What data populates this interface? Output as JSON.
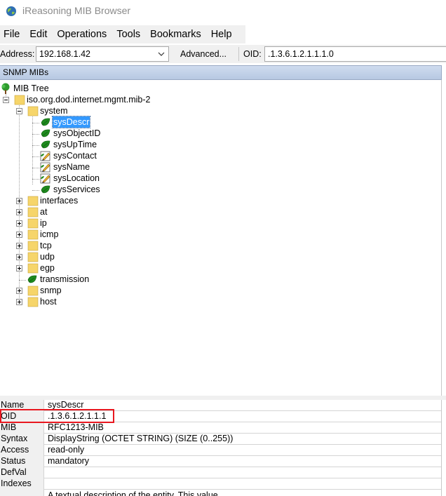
{
  "window": {
    "title": "iReasoning MIB Browser",
    "icon": "globe-icon"
  },
  "menu": [
    "File",
    "Edit",
    "Operations",
    "Tools",
    "Bookmarks",
    "Help"
  ],
  "toolbar": {
    "address_label": "Address:",
    "address_value": "192.168.1.42",
    "advanced_label": "Advanced...",
    "oid_label": "OID:",
    "oid_value": ".1.3.6.1.2.1.1.1.0"
  },
  "tree_panel": {
    "header": "SNMP MIBs",
    "nodes": [
      {
        "label": "MIB Tree",
        "icon": "tree-icon"
      },
      {
        "label": "iso.org.dod.internet.mgmt.mib-2",
        "icon": "folder-icon",
        "expanded": true
      },
      {
        "label": "system",
        "icon": "folder-icon",
        "expanded": true
      },
      {
        "label": "sysDescr",
        "icon": "leaf-icon",
        "selected": true
      },
      {
        "label": "sysObjectID",
        "icon": "leaf-icon"
      },
      {
        "label": "sysUpTime",
        "icon": "leaf-icon"
      },
      {
        "label": "sysContact",
        "icon": "writable-leaf-icon"
      },
      {
        "label": "sysName",
        "icon": "writable-leaf-icon"
      },
      {
        "label": "sysLocation",
        "icon": "writable-leaf-icon"
      },
      {
        "label": "sysServices",
        "icon": "leaf-icon"
      },
      {
        "label": "interfaces",
        "icon": "folder-icon"
      },
      {
        "label": "at",
        "icon": "folder-icon"
      },
      {
        "label": "ip",
        "icon": "folder-icon"
      },
      {
        "label": "icmp",
        "icon": "folder-icon"
      },
      {
        "label": "tcp",
        "icon": "folder-icon"
      },
      {
        "label": "udp",
        "icon": "folder-icon"
      },
      {
        "label": "egp",
        "icon": "folder-icon"
      },
      {
        "label": "transmission",
        "icon": "leaf-icon"
      },
      {
        "label": "snmp",
        "icon": "folder-icon"
      },
      {
        "label": "host",
        "icon": "folder-icon"
      }
    ]
  },
  "properties": [
    {
      "key": "Name",
      "value": "sysDescr"
    },
    {
      "key": "OID",
      "value": ".1.3.6.1.2.1.1.1"
    },
    {
      "key": "MIB",
      "value": "RFC1213-MIB"
    },
    {
      "key": "Syntax",
      "value": "DisplayString (OCTET STRING) (SIZE (0..255))"
    },
    {
      "key": "Access",
      "value": "read-only"
    },
    {
      "key": "Status",
      "value": "mandatory"
    },
    {
      "key": "DefVal",
      "value": ""
    },
    {
      "key": "Indexes",
      "value": ""
    }
  ],
  "description_preview": "A textual description of the entity.  This value",
  "colors": {
    "selection": "#3399ff",
    "highlight_box": "#e8171f",
    "leaf": "#1e8a1e",
    "folder": "#f6d56a"
  }
}
